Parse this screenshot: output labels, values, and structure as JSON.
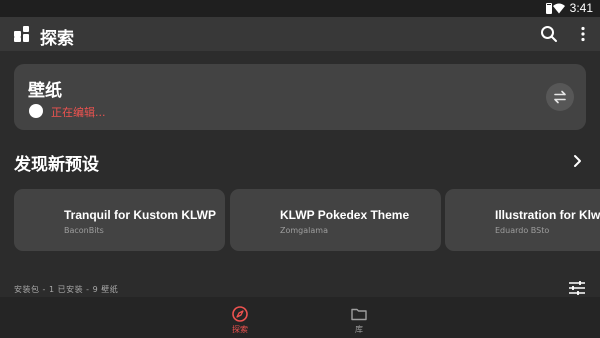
{
  "status_bar": {
    "time": "3:41"
  },
  "app_bar": {
    "title": "探索"
  },
  "wallpaper_card": {
    "title": "壁纸",
    "status": "正在编辑..."
  },
  "presets_section": {
    "title": "发现新预设",
    "items": [
      {
        "name": "Tranquil for Kustom KLWP",
        "author": "BaconBits"
      },
      {
        "name": "KLWP Pokedex Theme",
        "author": "Zomgalama"
      },
      {
        "name": "Illustration for Klwp",
        "author": "Eduardo BSto"
      }
    ]
  },
  "footer": {
    "summary": "安装包 - 1 已安装 - 9 壁纸"
  },
  "bottom_nav": {
    "items": [
      {
        "label": "探索",
        "icon": "compass-icon",
        "active": true
      },
      {
        "label": "库",
        "icon": "folder-icon",
        "active": false
      }
    ]
  },
  "colors": {
    "accent": "#ef5350",
    "background": "#2c2c2c",
    "card": "#434343"
  }
}
